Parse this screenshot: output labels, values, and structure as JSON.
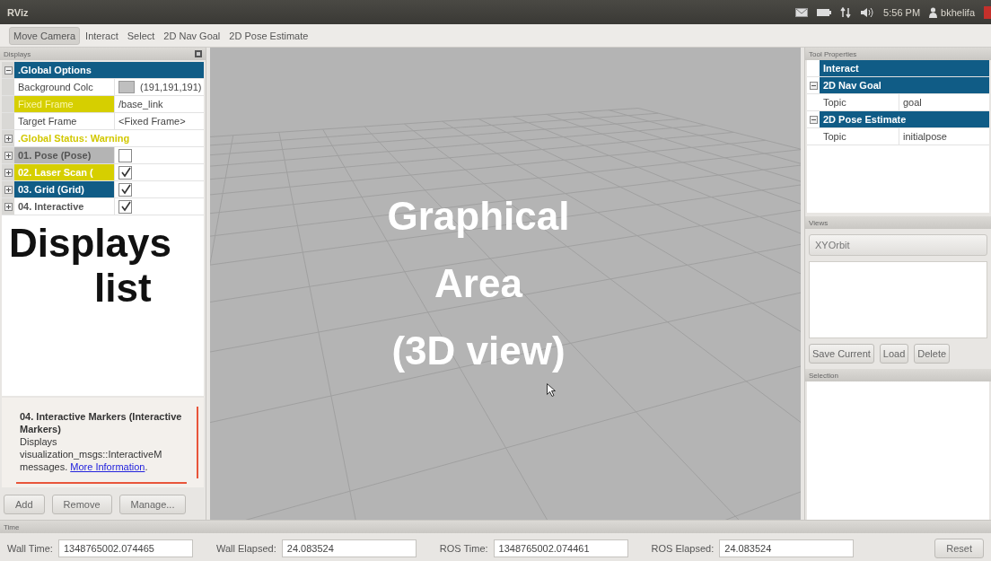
{
  "window": {
    "title": "RViz"
  },
  "top_panel": {
    "clock": "5:56 PM",
    "user": "bkhelifa"
  },
  "toolbar": {
    "tools": [
      {
        "label": "Move Camera",
        "selected": true
      },
      {
        "label": "Interact",
        "selected": false
      },
      {
        "label": "Select",
        "selected": false
      },
      {
        "label": "2D Nav Goal",
        "selected": false
      },
      {
        "label": "2D Pose Estimate",
        "selected": false
      }
    ]
  },
  "displays_panel": {
    "title": "Displays",
    "tree": [
      {
        "kind": "category",
        "label": ".Global Options",
        "expanded": true,
        "children": [
          {
            "kind": "property",
            "label": "Background Colc",
            "value": "(191,191,191)",
            "color": "#bfbfbf",
            "warning": false
          },
          {
            "kind": "property",
            "label": "Fixed Frame",
            "value": "/base_link",
            "warning": true
          },
          {
            "kind": "property",
            "label": "Target Frame",
            "value": "<Fixed Frame>",
            "warning": false
          }
        ]
      },
      {
        "kind": "status",
        "label": ".Global Status: Warning",
        "warning": true,
        "expanded": false
      },
      {
        "kind": "display",
        "label": "01. Pose (Pose)",
        "checked": false,
        "warning": false,
        "disabled": true,
        "selected": false,
        "expanded": false
      },
      {
        "kind": "display",
        "label": "02. Laser Scan (",
        "checked": true,
        "warning": true,
        "disabled": false,
        "selected": false,
        "expanded": false
      },
      {
        "kind": "display",
        "label": "03. Grid (Grid)",
        "checked": true,
        "warning": false,
        "disabled": false,
        "selected": true,
        "expanded": false
      },
      {
        "kind": "display",
        "label": "04. Interactive",
        "checked": true,
        "warning": false,
        "disabled": false,
        "selected": false,
        "expanded": false
      }
    ],
    "overlay_lines": [
      "Displays",
      "list"
    ],
    "description": {
      "title": "04. Interactive Markers (Interactive Markers)",
      "text": "Displays visualization_msgs::InteractiveM messages.",
      "link": "More Information",
      "after_link": "."
    },
    "buttons": [
      "Add",
      "Remove",
      "Manage..."
    ]
  },
  "viewport": {
    "overlay_lines": [
      "Graphical",
      "Area",
      "(3D view)"
    ]
  },
  "tool_properties": {
    "title": "Tool Properties",
    "tree": [
      {
        "kind": "category",
        "label": "Interact"
      },
      {
        "kind": "category",
        "label": "2D Nav Goal",
        "expanded": true,
        "children": [
          {
            "kind": "property",
            "label": "Topic",
            "value": "goal"
          }
        ]
      },
      {
        "kind": "category",
        "label": "2D Pose Estimate",
        "expanded": true,
        "children": [
          {
            "kind": "property",
            "label": "Topic",
            "value": "initialpose"
          }
        ]
      }
    ]
  },
  "views": {
    "title": "Views",
    "view_type": "XYOrbit",
    "buttons": [
      "Save Current",
      "Load",
      "Delete"
    ]
  },
  "selection": {
    "title": "Selection"
  },
  "time_panel": {
    "title": "Time",
    "fields": [
      {
        "label": "Wall Time:",
        "value": "1348765002.074465"
      },
      {
        "label": "Wall Elapsed:",
        "value": "24.083524"
      },
      {
        "label": "ROS Time:",
        "value": "1348765002.074461"
      },
      {
        "label": "ROS Elapsed:",
        "value": "24.083524"
      }
    ],
    "reset": "Reset"
  }
}
